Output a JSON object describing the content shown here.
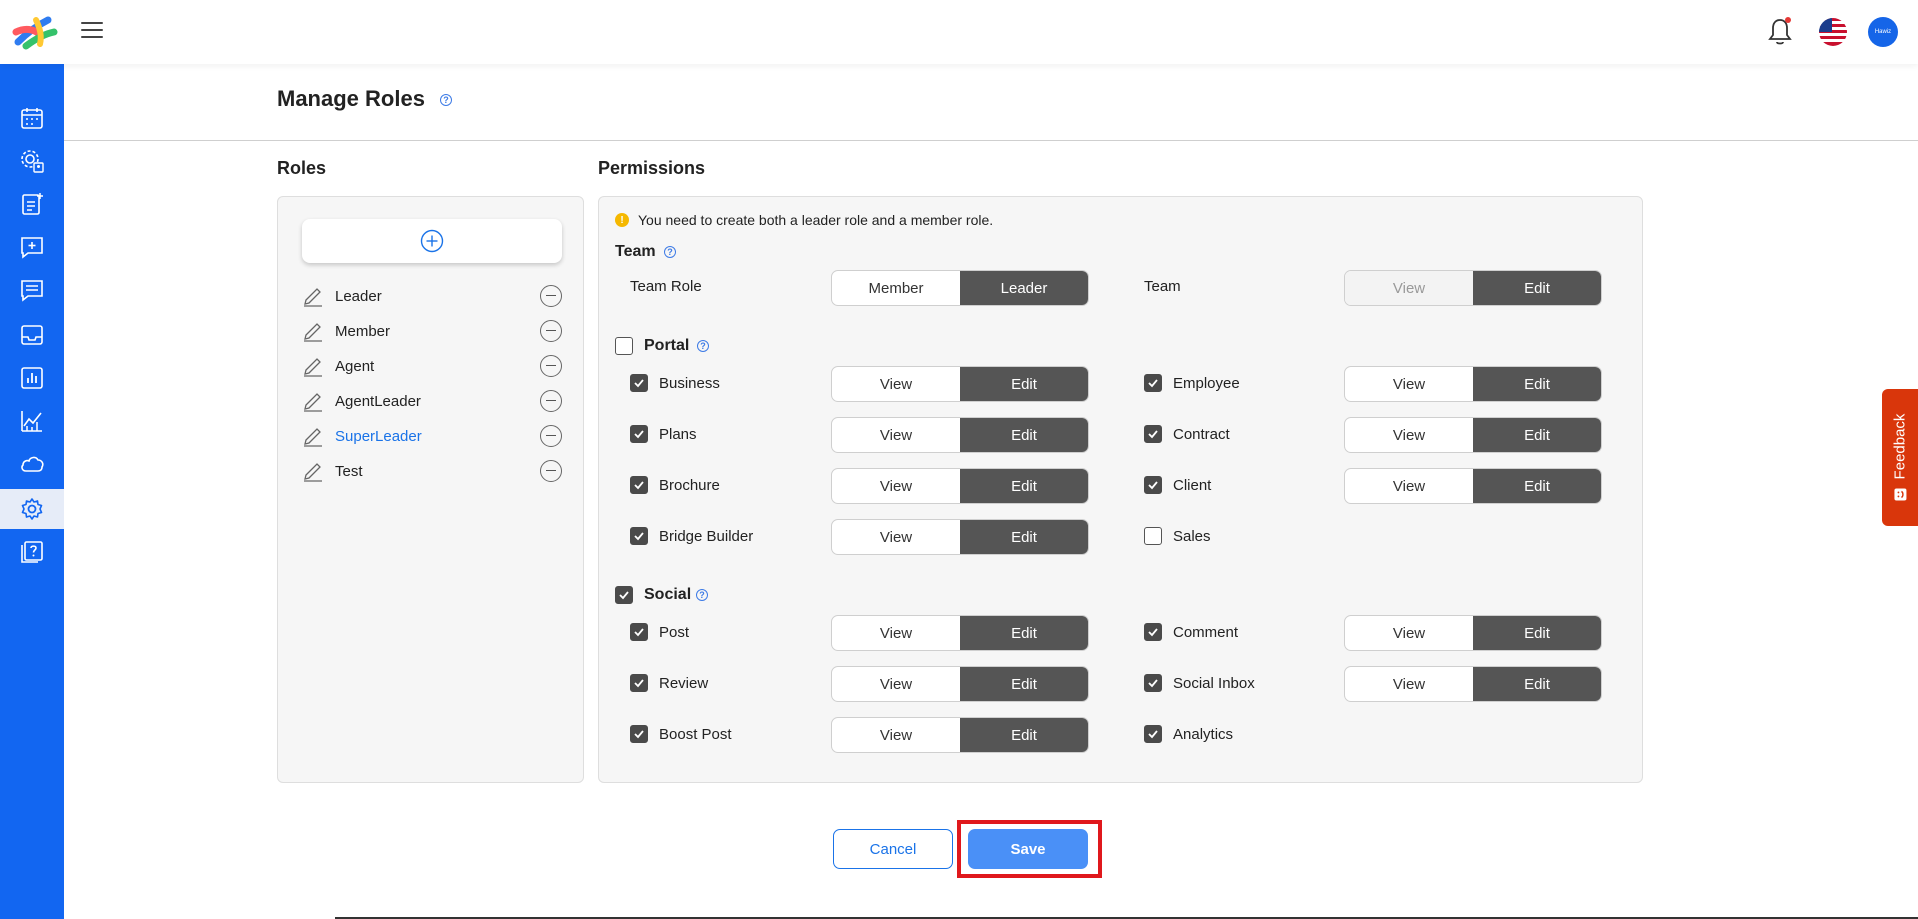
{
  "header": {
    "avatar_text": "Hawiz"
  },
  "sidebar": {
    "items": [
      {
        "icon": "calendar-icon"
      },
      {
        "icon": "settings-user-icon"
      },
      {
        "icon": "add-document-icon"
      },
      {
        "icon": "add-message-icon"
      },
      {
        "icon": "message-icon"
      },
      {
        "icon": "inbox-icon"
      },
      {
        "icon": "report-icon"
      },
      {
        "icon": "analytics-icon"
      },
      {
        "icon": "cloud-icon"
      },
      {
        "icon": "gear-icon",
        "active": true
      },
      {
        "icon": "help-book-icon"
      }
    ]
  },
  "page": {
    "title": "Manage Roles"
  },
  "roles": {
    "heading": "Roles",
    "items": [
      {
        "name": "Leader"
      },
      {
        "name": "Member"
      },
      {
        "name": "Agent"
      },
      {
        "name": "AgentLeader"
      },
      {
        "name": "SuperLeader",
        "selected": true
      },
      {
        "name": "Test"
      }
    ]
  },
  "permissions": {
    "heading": "Permissions",
    "notice": "You need to create both a leader role and a member role.",
    "team": {
      "label": "Team",
      "team_role_label": "Team Role",
      "team_role_options": [
        "Member",
        "Leader"
      ],
      "team_role_selected": "Leader",
      "team_label": "Team",
      "team_options": [
        "View",
        "Edit"
      ],
      "team_selected": "Edit"
    },
    "portal": {
      "label": "Portal",
      "checked": false,
      "items": [
        {
          "label": "Business",
          "checked": true,
          "options": [
            "View",
            "Edit"
          ],
          "selected": "Edit"
        },
        {
          "label": "Employee",
          "checked": true,
          "options": [
            "View",
            "Edit"
          ],
          "selected": "Edit"
        },
        {
          "label": "Plans",
          "checked": true,
          "options": [
            "View",
            "Edit"
          ],
          "selected": "Edit"
        },
        {
          "label": "Contract",
          "checked": true,
          "options": [
            "View",
            "Edit"
          ],
          "selected": "Edit"
        },
        {
          "label": "Brochure",
          "checked": true,
          "options": [
            "View",
            "Edit"
          ],
          "selected": "Edit"
        },
        {
          "label": "Client",
          "checked": true,
          "options": [
            "View",
            "Edit"
          ],
          "selected": "Edit"
        },
        {
          "label": "Bridge Builder",
          "checked": true,
          "options": [
            "View",
            "Edit"
          ],
          "selected": "Edit"
        },
        {
          "label": "Sales",
          "checked": false
        }
      ]
    },
    "social": {
      "label": "Social",
      "checked": true,
      "items": [
        {
          "label": "Post",
          "checked": true,
          "options": [
            "View",
            "Edit"
          ],
          "selected": "Edit"
        },
        {
          "label": "Comment",
          "checked": true,
          "options": [
            "View",
            "Edit"
          ],
          "selected": "Edit"
        },
        {
          "label": "Review",
          "checked": true,
          "options": [
            "View",
            "Edit"
          ],
          "selected": "Edit"
        },
        {
          "label": "Social Inbox",
          "checked": true,
          "options": [
            "View",
            "Edit"
          ],
          "selected": "Edit"
        },
        {
          "label": "Boost Post",
          "checked": true,
          "options": [
            "View",
            "Edit"
          ],
          "selected": "Edit"
        },
        {
          "label": "Analytics",
          "checked": true
        }
      ]
    }
  },
  "actions": {
    "cancel_label": "Cancel",
    "save_label": "Save"
  },
  "feedback": {
    "label": "Feedback"
  },
  "colors": {
    "sidebar": "#1266f1",
    "accent": "#1a73e8",
    "save": "#4a90f7",
    "segment_selected": "#555555",
    "highlight": "#e0181c",
    "feedback": "#d9360b"
  }
}
